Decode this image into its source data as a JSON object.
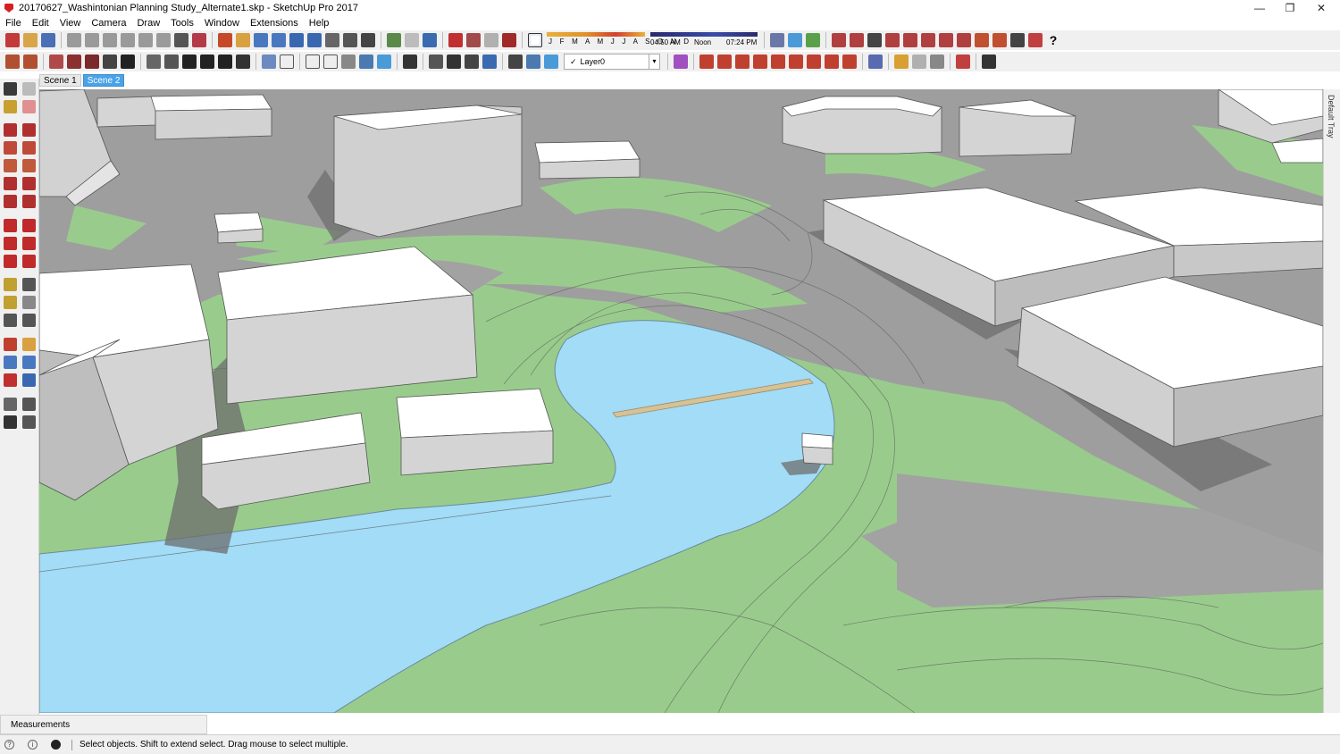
{
  "window": {
    "title": "20170627_Washintonian Planning Study_Alternate1.skp - SketchUp Pro 2017",
    "minimize_glyph": "—",
    "restore_glyph": "❐",
    "close_glyph": "✕"
  },
  "menu": [
    "File",
    "Edit",
    "View",
    "Camera",
    "Draw",
    "Tools",
    "Window",
    "Extensions",
    "Help"
  ],
  "shadow_settings": {
    "months": "J F M A M J J A S O N D",
    "time_start": "04:50 AM",
    "time_noon": "Noon",
    "time_end": "07:24 PM"
  },
  "layer": {
    "current": "Layer0",
    "check_glyph": "✓",
    "arrow_glyph": "▾"
  },
  "help_glyph": "?",
  "scenes": [
    {
      "label": "Scene 1",
      "active": false
    },
    {
      "label": "Scene 2",
      "active": true
    }
  ],
  "default_tray_label": "Default Tray",
  "measurements_label": "Measurements",
  "status": {
    "message": "Select objects. Shift to extend select. Drag mouse to select multiple.",
    "geo_glyph": "?",
    "info_glyph": "i"
  },
  "colors": {
    "ground": "#9e9e9e",
    "grass": "#99cc8c",
    "water": "#a2dcf6",
    "building_top": "#ffffff",
    "building_side": "#d0d0d0",
    "shadow": "#6d6d6d",
    "bridge": "#d8c294",
    "selected_tab": "#4aa3e6"
  },
  "icons": {
    "toolbar_main": [
      "new-model",
      "open",
      "save",
      "cut",
      "copy",
      "paste",
      "erase",
      "undo",
      "redo",
      "print",
      "model-info",
      "orbit",
      "pan",
      "zoom",
      "zoom-window",
      "zoom-extents",
      "previous",
      "position-camera",
      "look-around",
      "walk",
      "get-models",
      "share-model",
      "extension-warehouse",
      "3d-warehouse",
      "layout",
      "style-builder",
      "shadows-toggle",
      "sandbox-smoove",
      "sandbox-stamp",
      "sandbox-drape",
      "sandbox-detail",
      "sandbox-flip",
      "move",
      "push-pull",
      "tape",
      "protractor",
      "axes",
      "text",
      "3d-text",
      "dimension",
      "section",
      "help"
    ],
    "toolbar_views": [
      "iso-view",
      "top-view",
      "front-view",
      "right-view",
      "back-view",
      "left-view",
      "xray",
      "wireframe",
      "hidden-line",
      "shaded",
      "shaded-texture",
      "monochrome",
      "section-plane",
      "section-cuts",
      "section-fill",
      "layer-manager",
      "solid-union",
      "solid-intersect",
      "solid-subtract",
      "solid-trim",
      "solid-split",
      "solid-outer",
      "location",
      "terrain",
      "dynamic-component",
      "interact",
      "options",
      "attributes",
      "sandbox-from-contours",
      "sandbox-from-scratch",
      "add-location"
    ],
    "left_tools": [
      "select",
      "make-component",
      "paint-bucket",
      "eraser",
      "line",
      "freehand",
      "rectangle",
      "rotated-rectangle",
      "circle",
      "polygon",
      "arc",
      "2pt-arc",
      "3pt-arc",
      "pie",
      "move",
      "push-pull",
      "rotate",
      "follow-me",
      "scale",
      "offset",
      "tape-measure",
      "dimension",
      "protractor",
      "text",
      "axes",
      "3d-text",
      "orbit",
      "pan",
      "zoom",
      "zoom-window",
      "zoom-extents",
      "previous",
      "position-camera",
      "look-around",
      "walk",
      "section-plane"
    ]
  }
}
